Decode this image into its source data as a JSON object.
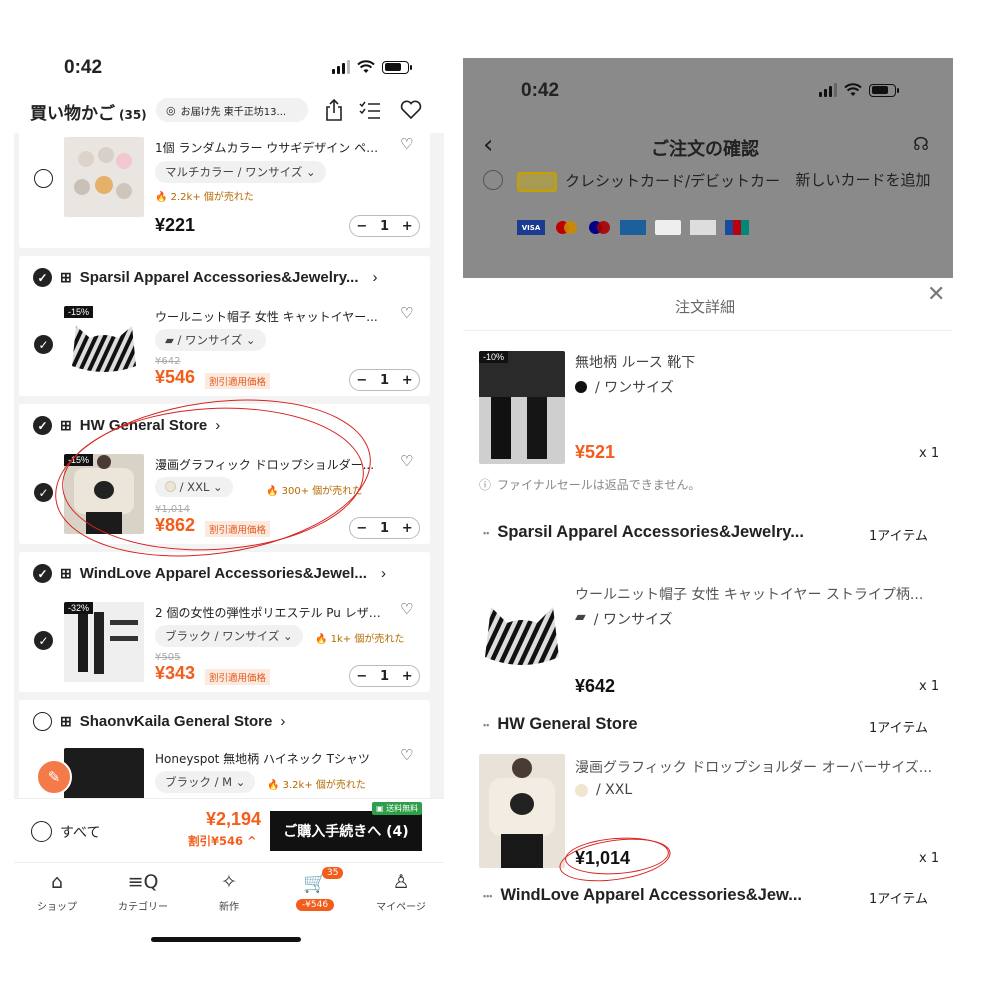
{
  "left": {
    "status": {
      "time": "0:42"
    },
    "header": {
      "title": "買い物かご",
      "count": "(35)",
      "address": "お届け先 東千正坊13..."
    },
    "items": [
      {
        "name": "1個 ランダムカラー ウサギデザイン ペ…",
        "variant": "マルチカラー / ワンサイズ",
        "sold": "2.2k+ 個が売れた",
        "price": "¥221",
        "qty": "1"
      },
      {
        "store": "Sparsil Apparel Accessories&Jewelry...",
        "discount": "-15%",
        "name": "ウールニット帽子 女性 キャットイヤー...",
        "variant": "/ ワンサイズ",
        "old_price": "¥642",
        "price": "¥546",
        "price_tag": "割引適用価格",
        "qty": "1"
      },
      {
        "store": "HW General Store",
        "discount": "-15%",
        "name": "漫画グラフィック ドロップショルダー...",
        "variant": "/ XXL",
        "sold": "300+ 個が売れた",
        "old_price": "¥1,014",
        "price": "¥862",
        "price_tag": "割引適用価格",
        "qty": "1"
      },
      {
        "store": "WindLove Apparel Accessories&Jewel...",
        "discount": "-32%",
        "name": "2 個の女性の弾性ポリエステル Pu レザ…",
        "variant": "ブラック / ワンサイズ",
        "sold": "1k+ 個が売れた",
        "old_price": "¥505",
        "price": "¥343",
        "price_tag": "割引適用価格",
        "qty": "1"
      },
      {
        "store": "ShaonvKaila General Store",
        "name": "Honeyspot 無地柄 ハイネック Tシャツ",
        "variant": "ブラック / M",
        "sold": "3.2k+ 個が売れた"
      }
    ],
    "bottom": {
      "select_all": "すべて",
      "total": "¥2,194",
      "discount": "割引¥546",
      "checkout": "ご購入手続きへ (4)",
      "free_ship": "送料無料"
    },
    "tabs": [
      {
        "label": "ショップ",
        "icon": "home-icon"
      },
      {
        "label": "カテゴリー",
        "icon": "category-search-icon"
      },
      {
        "label": "新作",
        "icon": "new-sparkle-icon"
      },
      {
        "label": "-¥546",
        "icon": "cart-icon",
        "badge": "35"
      },
      {
        "label": "マイページ",
        "icon": "person-icon"
      }
    ]
  },
  "right": {
    "status": {
      "time": "0:42"
    },
    "header": {
      "title": "ご注文の確認"
    },
    "payment": {
      "label": "クレシットカード/デビットカー",
      "add_card": "新しいカードを追加"
    },
    "card_brands": [
      "VISA",
      "MC",
      "MAESTRO",
      "AMEX",
      "DINERS",
      "DISCOVER",
      "JCB"
    ],
    "sheet": {
      "title": "注文詳細",
      "items": [
        {
          "discount": "-10%",
          "name": "無地柄 ルース 靴下",
          "variant": "/ ワンサイズ",
          "price": "¥521",
          "qty": "x 1",
          "note": "ファイナルセールは返品できません。"
        },
        {
          "store": "Sparsil Apparel Accessories&Jewelry...",
          "count": "1アイテム",
          "name": "ウールニット帽子 女性 キャットイヤー ストライプ柄...",
          "variant": "/ ワンサイズ",
          "price": "¥642",
          "qty": "x 1"
        },
        {
          "store": "HW General Store",
          "count": "1アイテム",
          "name": "漫画グラフィック ドロップショルダー オーバーサイズ...",
          "variant": "/ XXL",
          "price": "¥1,014",
          "qty": "x 1"
        },
        {
          "store": "WindLove Apparel Accessories&Jew...",
          "count": "1アイテム"
        }
      ]
    }
  },
  "colors": {
    "accent": "#f25d1c",
    "annotation": "#d6231f",
    "free_ship": "#2e9e4a"
  }
}
